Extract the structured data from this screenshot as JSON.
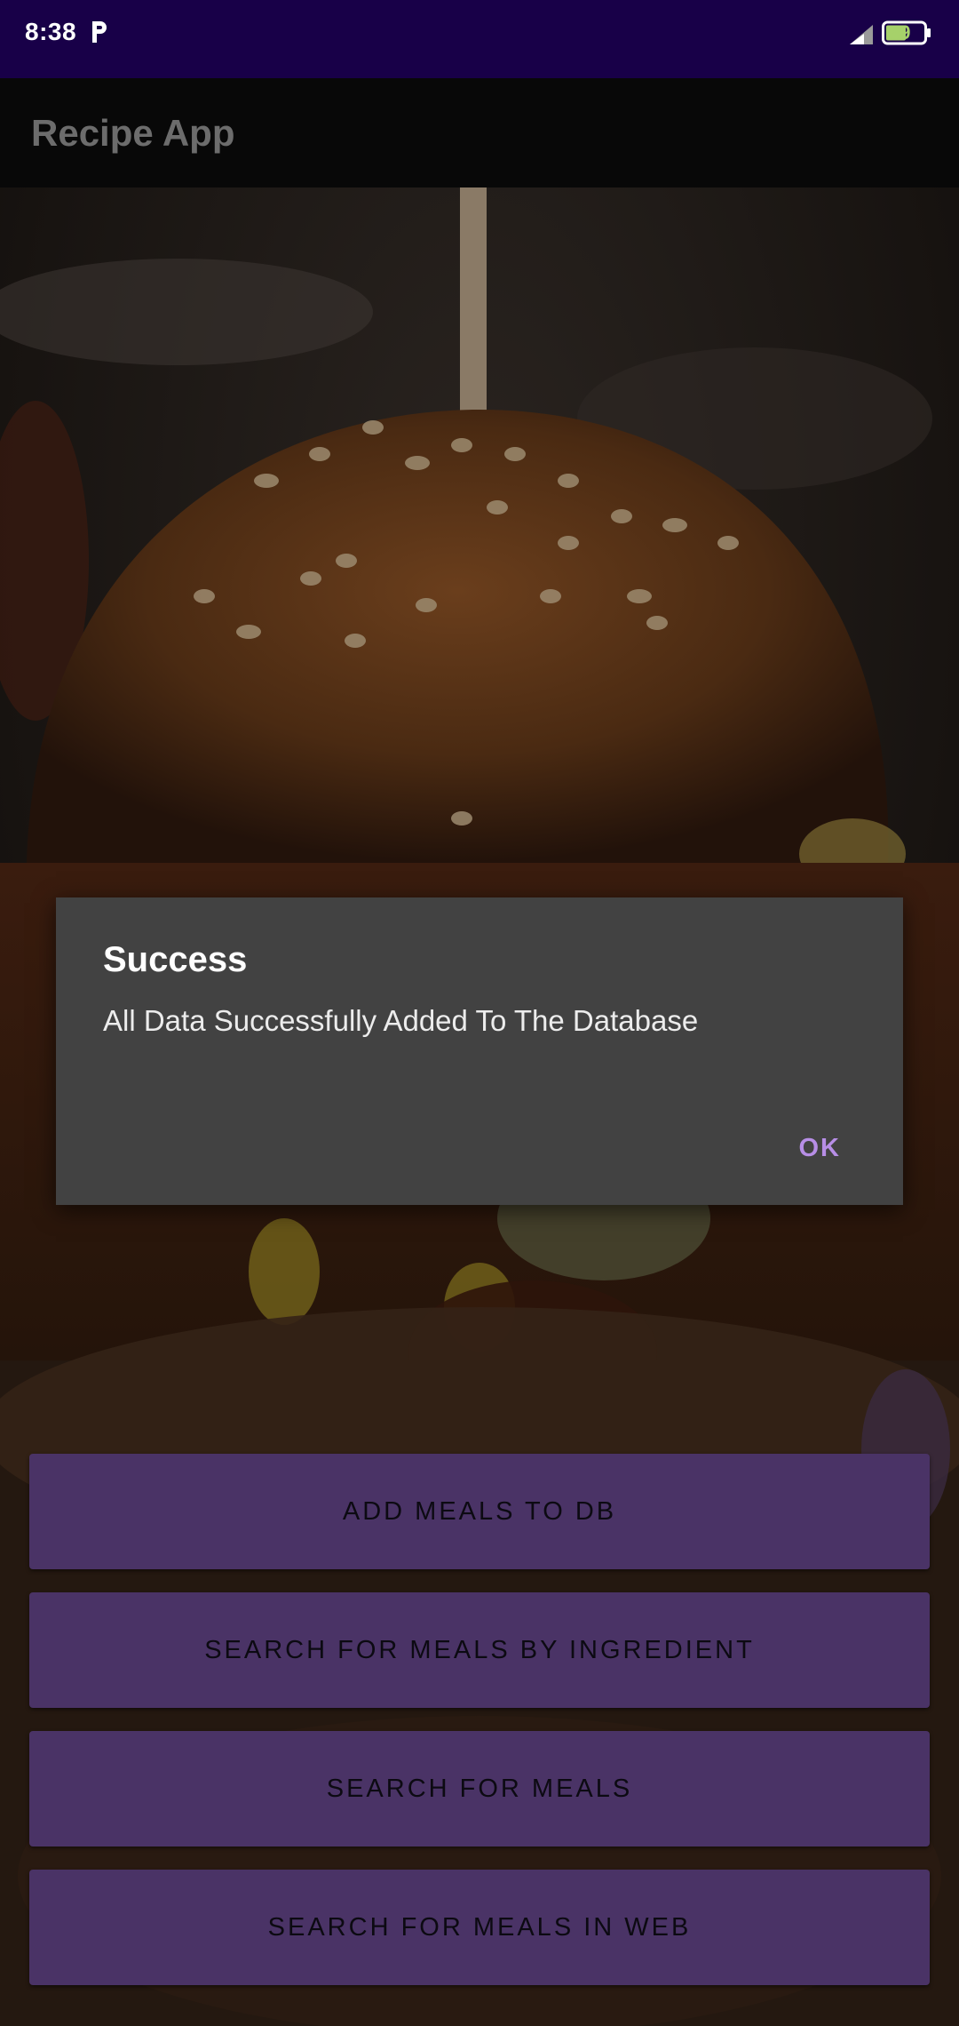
{
  "status_bar": {
    "time": "8:38",
    "battery": "69",
    "icons": [
      "p-icon",
      "signal-icon",
      "battery-icon"
    ]
  },
  "toolbar": {
    "title": "Recipe App"
  },
  "dialog": {
    "title": "Success",
    "message": "All Data Successfully Added To The Database",
    "ok_label": "OK"
  },
  "buttons": [
    {
      "label": "ADD MEALS TO DB"
    },
    {
      "label": "SEARCH FOR MEALS BY INGREDIENT"
    },
    {
      "label": "SEARCH FOR MEALS"
    },
    {
      "label": "SEARCH FOR MEALS IN WEB"
    }
  ],
  "colors": {
    "status_bar": "#180048",
    "button": "#4a3366",
    "dialog": "#424242",
    "accent": "#b78ee6"
  }
}
